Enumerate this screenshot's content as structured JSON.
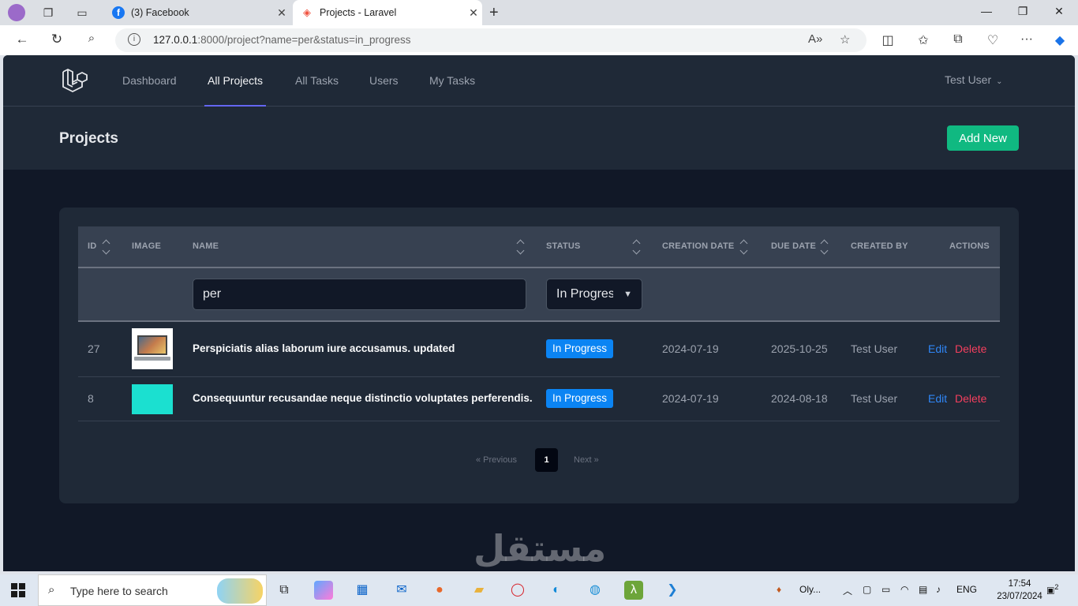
{
  "browser": {
    "tabs": [
      {
        "title": "(3) Facebook",
        "favicon": "facebook-icon"
      },
      {
        "title": "Projects - Laravel",
        "favicon": "laravel-icon"
      }
    ],
    "url_host": "127.0.0.1",
    "url_rest": ":8000/project?name=per&status=in_progress"
  },
  "nav": {
    "links": [
      "Dashboard",
      "All Projects",
      "All Tasks",
      "Users",
      "My Tasks"
    ],
    "active": "All Projects",
    "user": "Test User"
  },
  "header": {
    "title": "Projects",
    "add_label": "Add New"
  },
  "table": {
    "columns": [
      "ID",
      "IMAGE",
      "NAME",
      "STATUS",
      "CREATION DATE",
      "DUE DATE",
      "CREATED BY",
      "ACTIONS"
    ],
    "filters": {
      "name_value": "per",
      "status_value": "In Progress"
    },
    "rows": [
      {
        "id": "27",
        "image": "laptop",
        "name": "Perspiciatis alias laborum iure accusamus. updated",
        "status": "In Progress",
        "created": "2024-07-19",
        "due": "2025-10-25",
        "created_by": "Test User",
        "edit": "Edit",
        "delete": "Delete"
      },
      {
        "id": "8",
        "image": "teal",
        "name": "Consequuntur recusandae neque distinctio voluptates perferendis.",
        "status": "In Progress",
        "created": "2024-07-19",
        "due": "2024-08-18",
        "created_by": "Test User",
        "edit": "Edit",
        "delete": "Delete"
      }
    ]
  },
  "pagination": {
    "prev": "« Previous",
    "current": "1",
    "next": "Next »"
  },
  "watermark": "مستقل",
  "taskbar": {
    "search_placeholder": "Type here to search",
    "app_label": "Oly...",
    "lang": "ENG",
    "time": "17:54",
    "date": "23/07/2024",
    "notifications": "2"
  },
  "colors": {
    "accent": "#6366f1",
    "add_button": "#10b981",
    "badge": "#0b84f3",
    "edit": "#2f86f6",
    "delete": "#f43f5e"
  }
}
